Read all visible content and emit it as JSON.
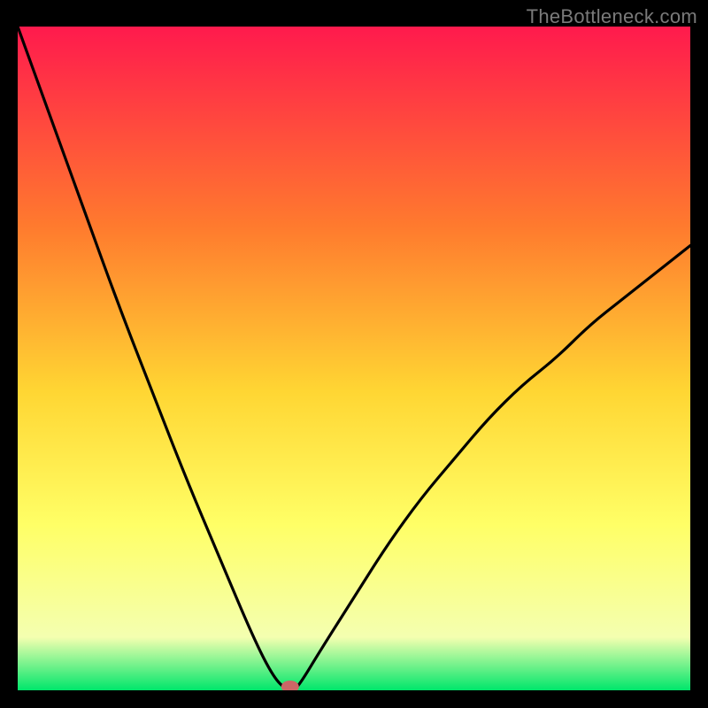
{
  "watermark": "TheBottleneck.com",
  "colors": {
    "frame": "#000000",
    "gradient_top": "#ff1a4d",
    "gradient_mid1": "#ff7a2e",
    "gradient_mid2": "#ffd633",
    "gradient_mid3": "#ffff66",
    "gradient_mid4": "#f4ffb0",
    "gradient_bottom": "#00e66b",
    "curve": "#000000",
    "marker": "#cc6666"
  },
  "chart_data": {
    "type": "line",
    "title": "",
    "xlabel": "",
    "ylabel": "",
    "x": [
      0.0,
      0.05,
      0.1,
      0.15,
      0.2,
      0.25,
      0.3,
      0.35,
      0.38,
      0.4,
      0.41,
      0.42,
      0.45,
      0.5,
      0.55,
      0.6,
      0.65,
      0.7,
      0.75,
      0.8,
      0.85,
      0.9,
      0.95,
      1.0
    ],
    "y": [
      1.0,
      0.86,
      0.72,
      0.58,
      0.45,
      0.32,
      0.2,
      0.08,
      0.02,
      0.0,
      0.0,
      0.01,
      0.06,
      0.14,
      0.22,
      0.29,
      0.35,
      0.41,
      0.46,
      0.5,
      0.55,
      0.59,
      0.63,
      0.67
    ],
    "xlim": [
      0,
      1
    ],
    "ylim": [
      0,
      1
    ],
    "marker": {
      "x": 0.405,
      "y": 0.0
    },
    "notes": "x and y are normalized to the plot area; y=0 is the bottom edge, y=1 is the top edge"
  }
}
